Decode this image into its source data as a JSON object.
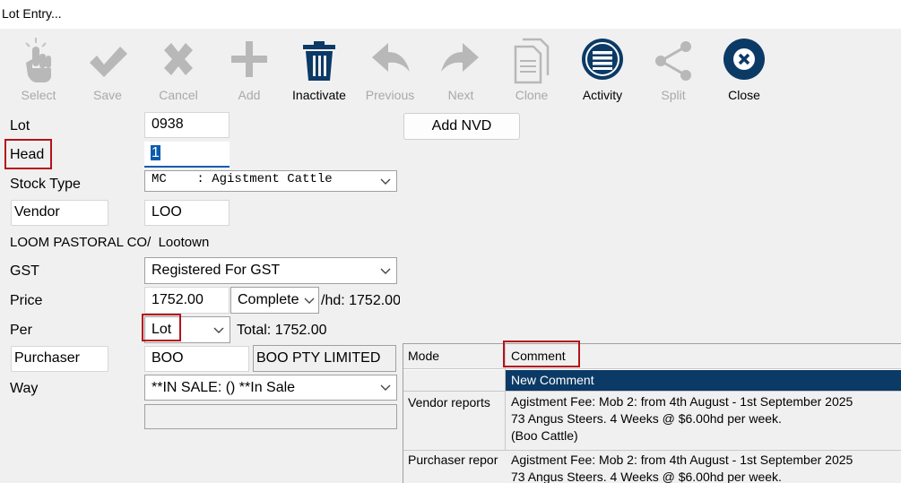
{
  "window": {
    "title": "Lot Entry..."
  },
  "toolbar": [
    {
      "label": "Select",
      "icon": "hand-pointer-icon",
      "enabled": false
    },
    {
      "label": "Save",
      "icon": "checkmark-icon",
      "enabled": false
    },
    {
      "label": "Cancel",
      "icon": "x-icon",
      "enabled": false
    },
    {
      "label": "Add",
      "icon": "plus-icon",
      "enabled": false
    },
    {
      "label": "Inactivate",
      "icon": "trash-icon",
      "enabled": true
    },
    {
      "label": "Previous",
      "icon": "arrow-left-icon",
      "enabled": false
    },
    {
      "label": "Next",
      "icon": "arrow-right-icon",
      "enabled": false
    },
    {
      "label": "Clone",
      "icon": "document-copy-icon",
      "enabled": false
    },
    {
      "label": "Activity",
      "icon": "list-icon",
      "enabled": true
    },
    {
      "label": "Split",
      "icon": "share-icon",
      "enabled": false
    },
    {
      "label": "Close",
      "icon": "close-icon",
      "enabled": true
    }
  ],
  "form": {
    "lot": {
      "label": "Lot",
      "value": "0938"
    },
    "head": {
      "label": "Head",
      "value": "1"
    },
    "stock_type": {
      "label": "Stock Type",
      "value": "MC    : Agistment Cattle"
    },
    "vendor": {
      "label": "Vendor",
      "value": "LOO",
      "name": "LOOM PASTORAL CO/  Lootown"
    },
    "gst": {
      "label": "GST",
      "value": "Registered For GST"
    },
    "price": {
      "label": "Price",
      "value": "1752.00",
      "mode": "Complete",
      "per_hd": "/hd: 1752.00"
    },
    "per": {
      "label": "Per",
      "value": "Lot",
      "total": "Total: 1752.00"
    },
    "purchaser": {
      "label": "Purchaser",
      "value": "BOO",
      "name": "BOO PTY LIMITED"
    },
    "way": {
      "label": "Way",
      "value": "**IN SALE: () **In Sale",
      "extra": ""
    },
    "add_nvd_label": "Add NVD"
  },
  "comments_grid": {
    "headers": [
      "Mode",
      "Comment"
    ],
    "new_row": "New Comment",
    "rows": [
      {
        "mode": "Vendor reports",
        "comment": [
          "Agistment Fee: Mob 2: from 4th August - 1st September 2025",
          "73 Angus Steers. 4 Weeks @ $6.00hd per week.",
          "(Boo Cattle)"
        ]
      },
      {
        "mode": "Purchaser repor",
        "comment": [
          "Agistment Fee: Mob 2: from 4th August - 1st September 2025",
          "73 Angus Steers. 4 Weeks @ $6.00hd per week."
        ]
      }
    ]
  },
  "colors": {
    "accent": "#0b3a66",
    "highlight_border": "#b5121b",
    "selected_row": "#0b3a66",
    "disabled": "#a9a9a9"
  }
}
